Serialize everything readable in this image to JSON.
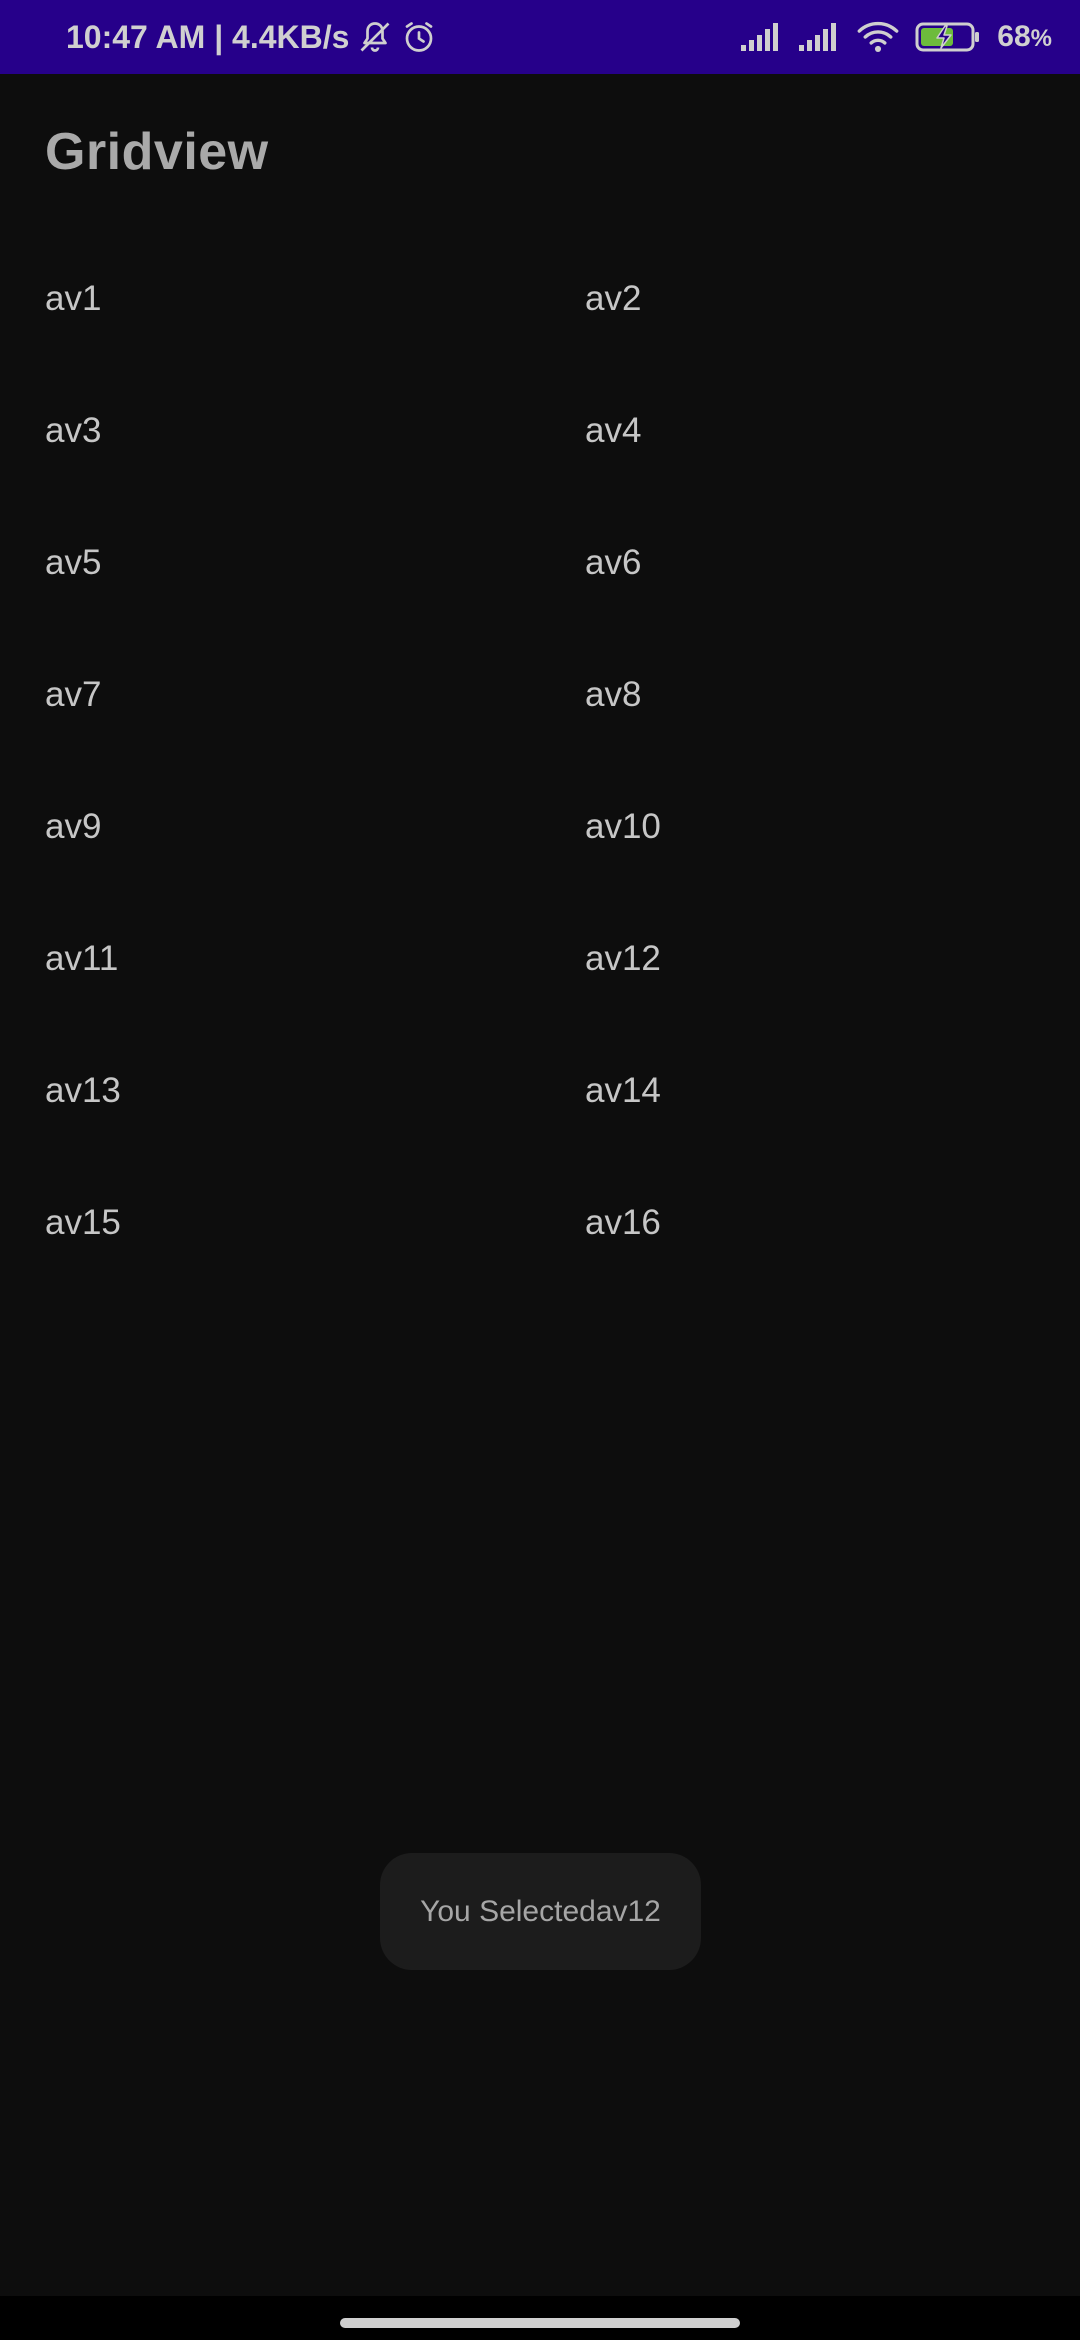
{
  "status_bar": {
    "time_speed": "10:47 AM | 4.4KB/s",
    "battery_pct": "68",
    "battery_unit": "%",
    "icons": [
      "notifications-off-icon",
      "alarm-icon",
      "signal-icon",
      "signal-icon",
      "wifi-icon",
      "battery-charging-icon"
    ]
  },
  "app": {
    "title": "Gridview"
  },
  "grid": {
    "items": [
      "av1",
      "av2",
      "av3",
      "av4",
      "av5",
      "av6",
      "av7",
      "av8",
      "av9",
      "av10",
      "av11",
      "av12",
      "av13",
      "av14",
      "av15",
      "av16"
    ]
  },
  "toast": {
    "message": "You Selectedav12"
  },
  "colors": {
    "status_bar_bg": "#26008a",
    "background": "#0d0d0d",
    "toast_bg": "#1c1c1c"
  }
}
